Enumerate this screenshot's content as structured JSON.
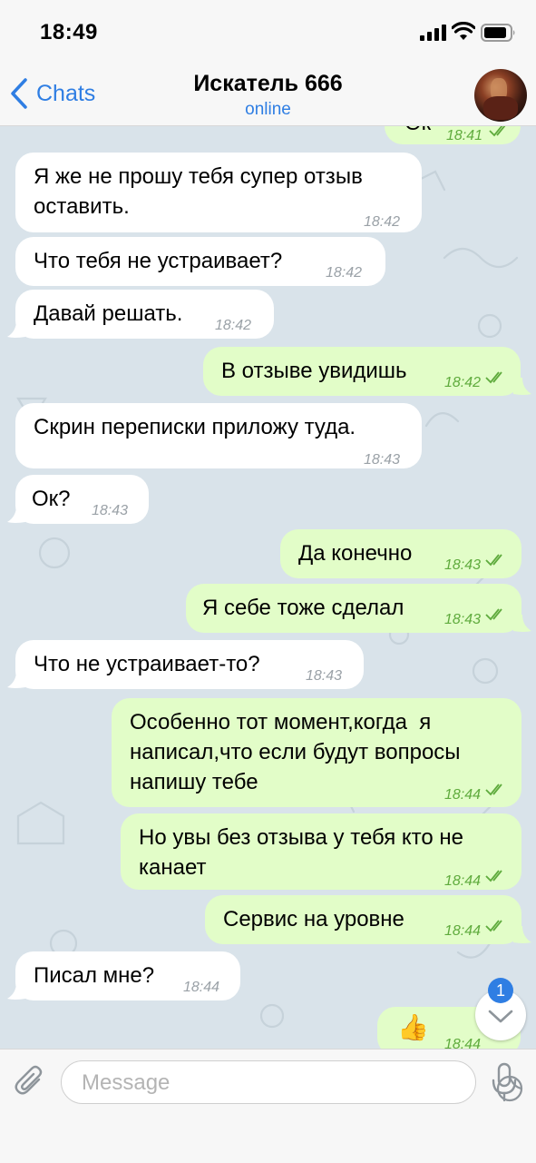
{
  "status": {
    "time": "18:49"
  },
  "header": {
    "back_label": "Chats",
    "title": "Искатель 666",
    "subtitle": "online"
  },
  "messages": [
    {
      "text": "Ок",
      "time": "18:41"
    },
    {
      "text": "Я же не прошу тебя супер отзыв\nоставить.",
      "time": "18:42"
    },
    {
      "text": "Что тебя не устраивает?",
      "time": "18:42"
    },
    {
      "text": "Давай решать.",
      "time": "18:42"
    },
    {
      "text": "В отзыве увидишь",
      "time": "18:42"
    },
    {
      "text": "Скрин переписки приложу туда.",
      "time": "18:43"
    },
    {
      "text": "Ок?",
      "time": "18:43"
    },
    {
      "text": "Да конечно",
      "time": "18:43"
    },
    {
      "text": "Я себе тоже сделал",
      "time": "18:43"
    },
    {
      "text": "Что не устраивает-то?",
      "time": "18:43"
    },
    {
      "text": "Особенно тот момент,когда  я\nнаписал,что если будут вопросы\nнапишу тебе",
      "time": "18:44"
    },
    {
      "text": "Но увы без отзыва у тебя кто не\nканает",
      "time": "18:44"
    },
    {
      "text": "Сервис на уровне",
      "time": "18:44"
    },
    {
      "text": "Писал мне?",
      "time": "18:44"
    },
    {
      "text": "👍",
      "time": "18:44"
    }
  ],
  "scroll_badge": "1",
  "composer": {
    "placeholder": "Message"
  },
  "colors": {
    "accent": "#2f7ee3",
    "outgoing_bubble": "#e2fdc8",
    "read_check": "#5fab3d",
    "chat_bg": "#d9e3ea"
  }
}
